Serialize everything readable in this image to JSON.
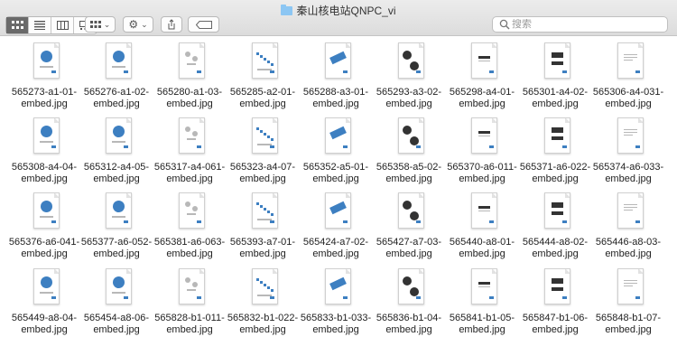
{
  "window": {
    "title": "秦山核电站QNPC_vi"
  },
  "toolbar": {
    "view_icons": [
      "icon-view-icon",
      "list-view-icon",
      "column-view-icon",
      "gallery-view-icon"
    ],
    "search_placeholder": "搜索"
  },
  "files": [
    [
      "565273-a1-01-",
      "embed.jpg"
    ],
    [
      "565276-a1-02-",
      "embed.jpg"
    ],
    [
      "565280-a1-03-",
      "embed.jpg"
    ],
    [
      "565285-a2-01-",
      "embed.jpg"
    ],
    [
      "565288-a3-01-",
      "embed.jpg"
    ],
    [
      "565293-a3-02-",
      "embed.jpg"
    ],
    [
      "565298-a4-01-",
      "embed.jpg"
    ],
    [
      "565301-a4-02-",
      "embed.jpg"
    ],
    [
      "565306-a4-031-",
      "embed.jpg"
    ],
    [
      "565308-a4-04-",
      "embed.jpg"
    ],
    [
      "565312-a4-05-",
      "embed.jpg"
    ],
    [
      "565317-a4-061-",
      "embed.jpg"
    ],
    [
      "565323-a4-07-",
      "embed.jpg"
    ],
    [
      "565352-a5-01-",
      "embed.jpg"
    ],
    [
      "565358-a5-02-",
      "embed.jpg"
    ],
    [
      "565370-a6-011-",
      "embed.jpg"
    ],
    [
      "565371-a6-022-",
      "embed.jpg"
    ],
    [
      "565374-a6-033-",
      "embed.jpg"
    ],
    [
      "565376-a6-041-",
      "embed.jpg"
    ],
    [
      "565377-a6-052-",
      "embed.jpg"
    ],
    [
      "565381-a6-063-",
      "embed.jpg"
    ],
    [
      "565393-a7-01-",
      "embed.jpg"
    ],
    [
      "565424-a7-02-",
      "embed.jpg"
    ],
    [
      "565427-a7-03-",
      "embed.jpg"
    ],
    [
      "565440-a8-01-",
      "embed.jpg"
    ],
    [
      "565444-a8-02-",
      "embed.jpg"
    ],
    [
      "565446-a8-03-",
      "embed.jpg"
    ],
    [
      "565449-a8-04-",
      "embed.jpg"
    ],
    [
      "565454-a8-06-",
      "embed.jpg"
    ],
    [
      "565828-b1-011-",
      "embed.jpg"
    ],
    [
      "565832-b1-022-",
      "embed.jpg"
    ],
    [
      "565833-b1-033-",
      "embed.jpg"
    ],
    [
      "565836-b1-04-",
      "embed.jpg"
    ],
    [
      "565841-b1-05-",
      "embed.jpg"
    ],
    [
      "565847-b1-06-",
      "embed.jpg"
    ],
    [
      "565848-b1-07-",
      "embed.jpg"
    ]
  ],
  "colors": {
    "accent": "#3d7fc1",
    "toolbar": "#dcdcdc"
  }
}
